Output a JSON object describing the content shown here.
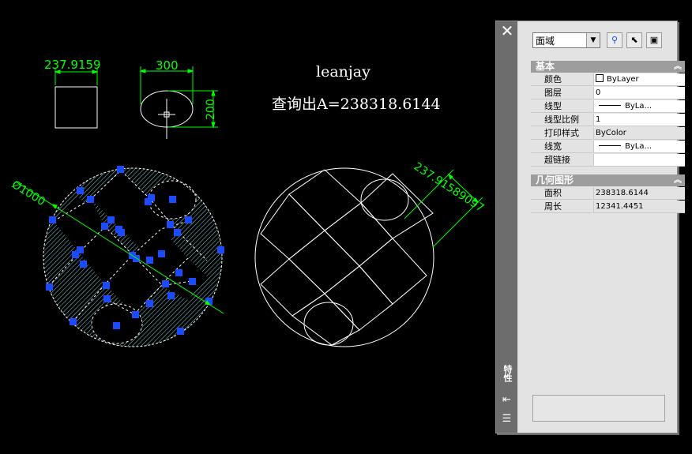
{
  "drawing": {
    "author_text": "leanjay",
    "query_text": "查询出A=238318.6144",
    "dim_left_width": "237.9159",
    "dim_ellipse_width": "300",
    "dim_ellipse_height": "200",
    "dim_diameter": "Ø1000",
    "dim_aligned": "237.9158909​7"
  },
  "palette": {
    "title": "特性",
    "close_icon": "close-icon",
    "object_selector": "面域",
    "sections": [
      {
        "title": "基本",
        "rows": [
          {
            "name": "颜色",
            "value": "ByLayer"
          },
          {
            "name": "图层",
            "value": "0"
          },
          {
            "name": "线型",
            "value": "ByLa..."
          },
          {
            "name": "线型比例",
            "value": "1"
          },
          {
            "name": "打印样式",
            "value": "ByColor"
          },
          {
            "name": "线宽",
            "value": "ByLa..."
          },
          {
            "name": "超链接",
            "value": ""
          }
        ]
      },
      {
        "title": "几何图形",
        "rows": [
          {
            "name": "面积",
            "value": "238318.6144"
          },
          {
            "name": "周长",
            "value": "12341.4451"
          }
        ]
      }
    ]
  },
  "colors": {
    "dimension": "#00ff00",
    "hatch": "#7fd6d6",
    "grip": "#1a4bff",
    "line": "#ffffff"
  }
}
